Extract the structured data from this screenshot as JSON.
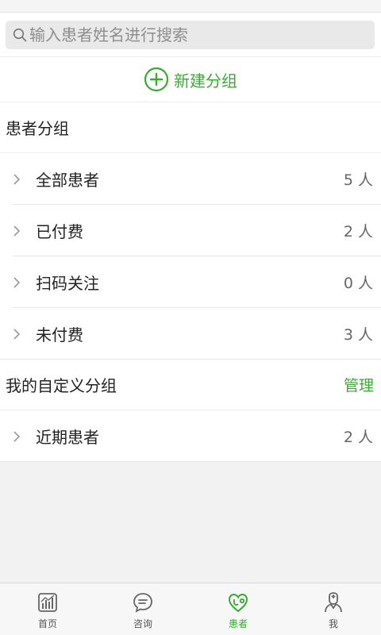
{
  "search": {
    "placeholder": "输入患者姓名进行搜索"
  },
  "new_group": {
    "label": "新建分组"
  },
  "patient_groups": {
    "title": "患者分组",
    "items": [
      {
        "name": "全部患者",
        "count": "5 人"
      },
      {
        "name": "已付费",
        "count": "2 人"
      },
      {
        "name": "扫码关注",
        "count": "0 人"
      },
      {
        "name": "未付费",
        "count": "3 人"
      }
    ]
  },
  "custom_groups": {
    "title": "我的自定义分组",
    "manage_label": "管理",
    "items": [
      {
        "name": "近期患者",
        "count": "2 人"
      }
    ]
  },
  "tabbar": {
    "items": [
      {
        "label": "首页",
        "icon": "chart-icon"
      },
      {
        "label": "咨询",
        "icon": "chat-icon"
      },
      {
        "label": "患者",
        "icon": "stethoscope-heart-icon",
        "active": true
      },
      {
        "label": "我",
        "icon": "doctor-icon"
      }
    ]
  },
  "colors": {
    "accent": "#3aaa35",
    "inactive": "#555555"
  }
}
